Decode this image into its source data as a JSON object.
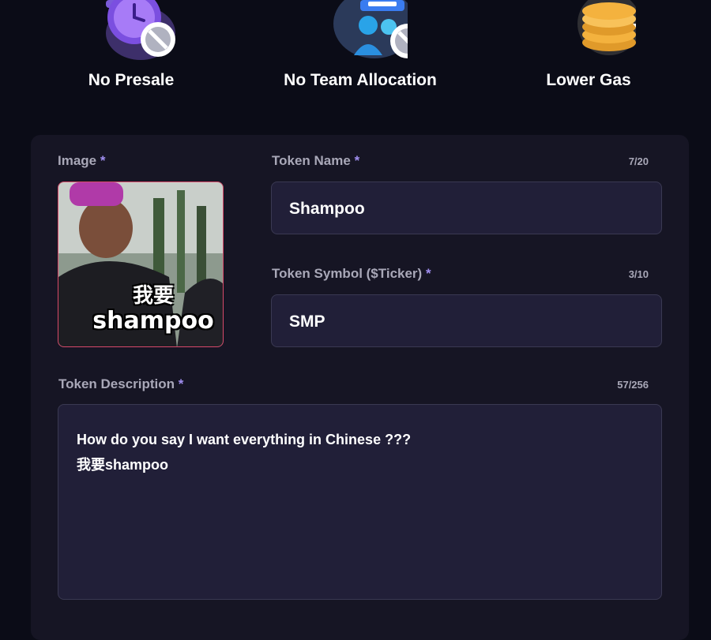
{
  "features": [
    {
      "label": "No Presale",
      "icon": "clock-no-icon"
    },
    {
      "label": "No Team Allocation",
      "icon": "team-no-icon"
    },
    {
      "label": "Lower Gas",
      "icon": "coins-down-icon"
    }
  ],
  "form": {
    "image": {
      "label": "Image",
      "required_mark": "*",
      "caption_line1": "我要",
      "caption_line2": "shampoo"
    },
    "token_name": {
      "label": "Token Name",
      "required_mark": "*",
      "counter": "7/20",
      "value": "Shampoo"
    },
    "token_symbol": {
      "label": "Token Symbol ($Ticker)",
      "required_mark": "*",
      "counter": "3/10",
      "value": "SMP"
    },
    "token_description": {
      "label": "Token Description",
      "required_mark": "*",
      "counter": "57/256",
      "value": "How do you say I want everything in Chinese ???\n我要shampoo"
    }
  },
  "colors": {
    "background": "#0b0c17",
    "panel": "#161524",
    "input_bg": "#211f38",
    "accent_required": "#a08ef0",
    "image_border": "#d8496a"
  }
}
